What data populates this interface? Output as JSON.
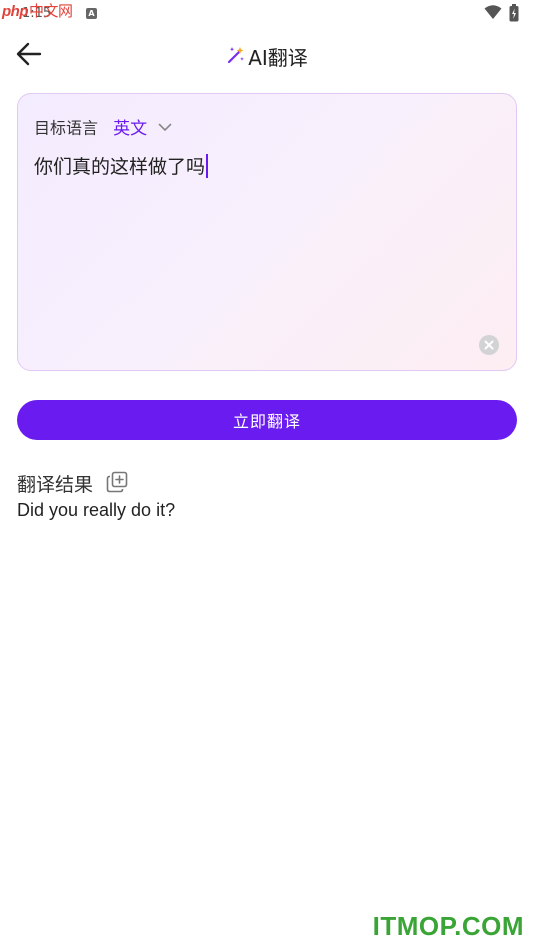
{
  "status_bar": {
    "logo_text": "php",
    "logo_cn": "中文网",
    "time": "1:15",
    "a_badge": "A",
    "icons": [
      "wifi-icon",
      "battery-icon"
    ]
  },
  "header": {
    "title": "AI翻译",
    "icons": [
      "back-arrow-icon",
      "magic-wand-icon"
    ]
  },
  "input_card": {
    "lang_label": "目标语言",
    "lang_value": "英文",
    "source_text": "你们真的这样做了吗",
    "icons": [
      "chevron-down-icon",
      "clear-icon"
    ]
  },
  "actions": {
    "translate_label": "立即翻译"
  },
  "result": {
    "title": "翻译结果",
    "text": "Did you really do it?",
    "icons": [
      "copy-icon"
    ]
  },
  "watermark": "ITMOP.COM",
  "colors": {
    "accent": "#6a1cf0",
    "card_border": "#e2c9f4",
    "watermark": "#3aa536"
  }
}
